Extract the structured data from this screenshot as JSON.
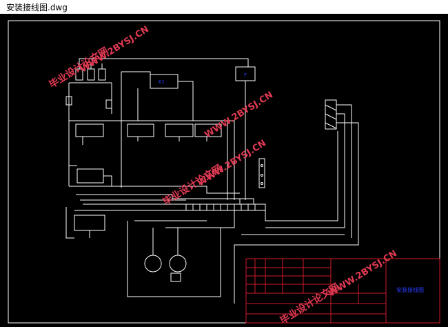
{
  "window": {
    "title": "安装接线图.dwg"
  },
  "drawing": {
    "components": {
      "k1": "K1",
      "f": "F"
    },
    "title_block": {
      "drawing_name": "安装接线图"
    },
    "watermarks": [
      {
        "cn": "毕业设计论文网",
        "url": "WWW.2BYSJ.CN"
      }
    ]
  },
  "colors": {
    "background": "#000000",
    "wire": "#ffffff",
    "annotation": "#2b3cff",
    "title_block": "#d01a2a",
    "watermark": "#e23a53"
  }
}
